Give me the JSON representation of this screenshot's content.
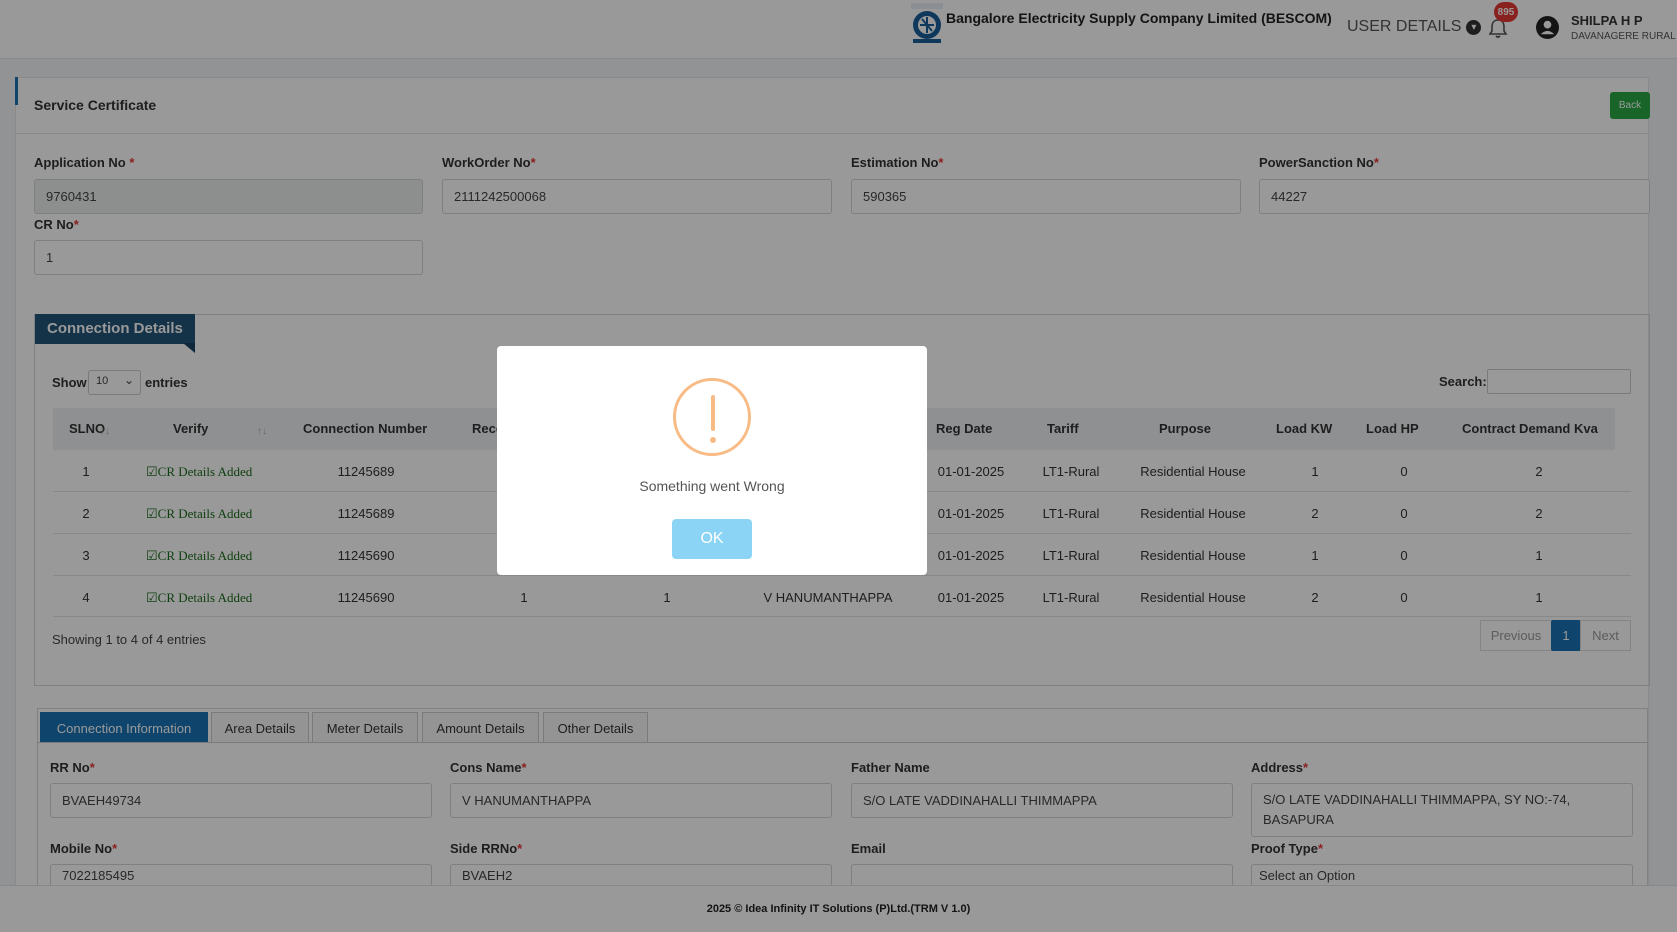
{
  "header": {
    "company": "Bangalore Electricity Supply Company Limited (BESCOM)",
    "user_details_label": "USER DETAILS",
    "notification_count": "895",
    "user_name": "SHILPA H P",
    "user_location": "DAVANAGERE RURAL"
  },
  "page": {
    "title": "Service Certificate",
    "back_label": "Back"
  },
  "fields": {
    "application_no": {
      "label": "Application No",
      "value": "9760431"
    },
    "workorder_no": {
      "label": "WorkOrder No",
      "value": "2111242500068"
    },
    "estimation_no": {
      "label": "Estimation No",
      "value": "590365"
    },
    "powersanction_no": {
      "label": "PowerSanction No",
      "value": "44227"
    },
    "cr_no": {
      "label": "CR No",
      "value": "1"
    }
  },
  "connection": {
    "title": "Connection Details",
    "show_label": "Show",
    "show_value": "10",
    "entries_label": "entries",
    "search_label": "Search:",
    "columns": [
      "SLNO",
      "Verify",
      "Connection Number",
      "Rece",
      "Reg Date",
      "Tariff",
      "Purpose",
      "Load KW",
      "Load HP",
      "Contract Demand Kva"
    ],
    "rows": [
      {
        "slno": "1",
        "verify": "CR Details Added",
        "conn": "11245689",
        "reg": "01-01-2025",
        "tariff": "LT1-Rural",
        "purpose": "Residential House",
        "kw": "1",
        "hp": "0",
        "kva": "2"
      },
      {
        "slno": "2",
        "verify": "CR Details Added",
        "conn": "11245689",
        "reg": "01-01-2025",
        "tariff": "LT1-Rural",
        "purpose": "Residential House",
        "kw": "2",
        "hp": "0",
        "kva": "2"
      },
      {
        "slno": "3",
        "verify": "CR Details Added",
        "conn": "11245690",
        "reg": "01-01-2025",
        "tariff": "LT1-Rural",
        "purpose": "Residential House",
        "kw": "1",
        "hp": "0",
        "kva": "1"
      },
      {
        "slno": "4",
        "verify": "CR Details Added",
        "conn": "11245690",
        "rece": "1",
        "col5": "1",
        "name": "V HANUMANTHAPPA",
        "reg": "01-01-2025",
        "tariff": "LT1-Rural",
        "purpose": "Residential House",
        "kw": "2",
        "hp": "0",
        "kva": "1"
      }
    ],
    "showing": "Showing 1 to 4 of 4 entries",
    "prev_label": "Previous",
    "page_label": "1",
    "next_label": "Next"
  },
  "tabs": [
    "Connection Information",
    "Area Details",
    "Meter Details",
    "Amount Details",
    "Other Details"
  ],
  "details": {
    "rr_no": {
      "label": "RR No",
      "value": "BVAEH49734"
    },
    "cons_name": {
      "label": "Cons Name",
      "value": "V HANUMANTHAPPA"
    },
    "father_name": {
      "label": "Father Name",
      "value": "S/O LATE VADDINAHALLI THIMMAPPA"
    },
    "address": {
      "label": "Address",
      "value": "S/O LATE VADDINAHALLI THIMMAPPA, SY NO:-74, BASAPURA"
    },
    "mobile_no": {
      "label": "Mobile No",
      "value": "7022185495"
    },
    "side_rr_no": {
      "label": "Side RRNo",
      "value": "BVAEH2"
    },
    "email": {
      "label": "Email",
      "value": ""
    },
    "proof_type": {
      "label": "Proof Type",
      "value": "Select an Option"
    }
  },
  "footer": "2025 © Idea Infinity IT Solutions (P)Ltd.(TRM V 1.0)",
  "modal": {
    "message": "Something went Wrong",
    "ok_label": "OK"
  }
}
